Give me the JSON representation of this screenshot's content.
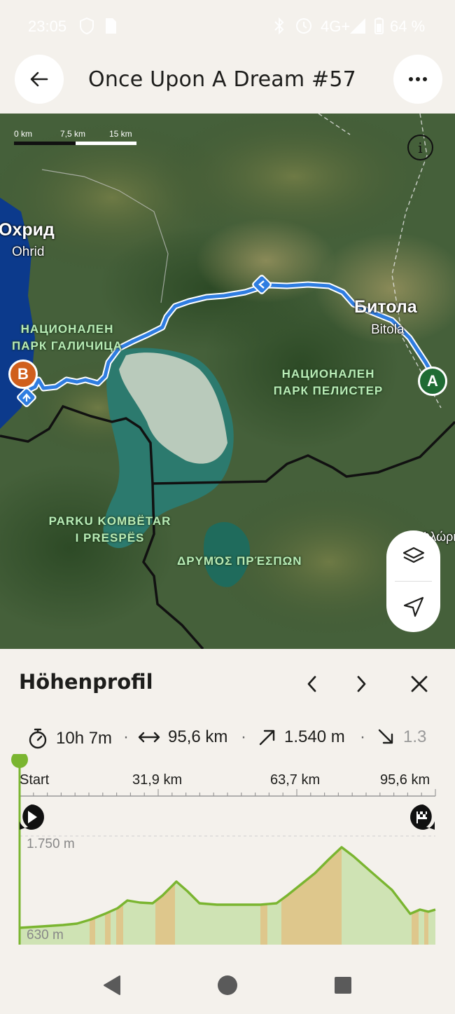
{
  "status_bar": {
    "time": "23:05",
    "network": "4G+",
    "battery": "64 %"
  },
  "header": {
    "title": "Once Upon A Dream #57"
  },
  "map": {
    "scale": {
      "labels": [
        "0 km",
        "7,5 km",
        "15 km"
      ]
    },
    "labels": {
      "ohrid_cyr": "Охрид",
      "ohrid_lat": "Ohrid",
      "bitola_cyr": "Битола",
      "bitola_lat": "Bitola",
      "park_galicica_1": "НАЦИОНАЛЕН",
      "park_galicica_2": "ПАРК ГАЛИЧИЦА",
      "park_pelister_1": "НАЦИОНАЛЕН",
      "park_pelister_2": "ПАРК ПЕЛИСТЕР",
      "park_prespes_1": "PARKU KOMBËTAR",
      "park_prespes_2": "I PRESPËS",
      "drymos": "ΔΡΥΜΌΣ ΠΡΈΣΠΩΝ",
      "edge_label": "Φλώρι"
    },
    "start_marker": "A",
    "end_marker": "B",
    "colors": {
      "route": "#2f7de1",
      "start": "#1f6b34",
      "end": "#d05f1c"
    }
  },
  "elevation": {
    "title": "Höhenprofil",
    "stats": {
      "duration": "10h 7m",
      "distance": "95,6 km",
      "ascent": "1.540 m",
      "descent": "1.3"
    },
    "axis_labels": [
      "Start",
      "31,9 km",
      "63,7 km",
      "95,6 km"
    ],
    "max_label": "1.750 m",
    "min_label": "630 m",
    "colors": {
      "line": "#7ab530",
      "fill": "#cfe3b4",
      "steep": "#f0a35c"
    }
  }
}
